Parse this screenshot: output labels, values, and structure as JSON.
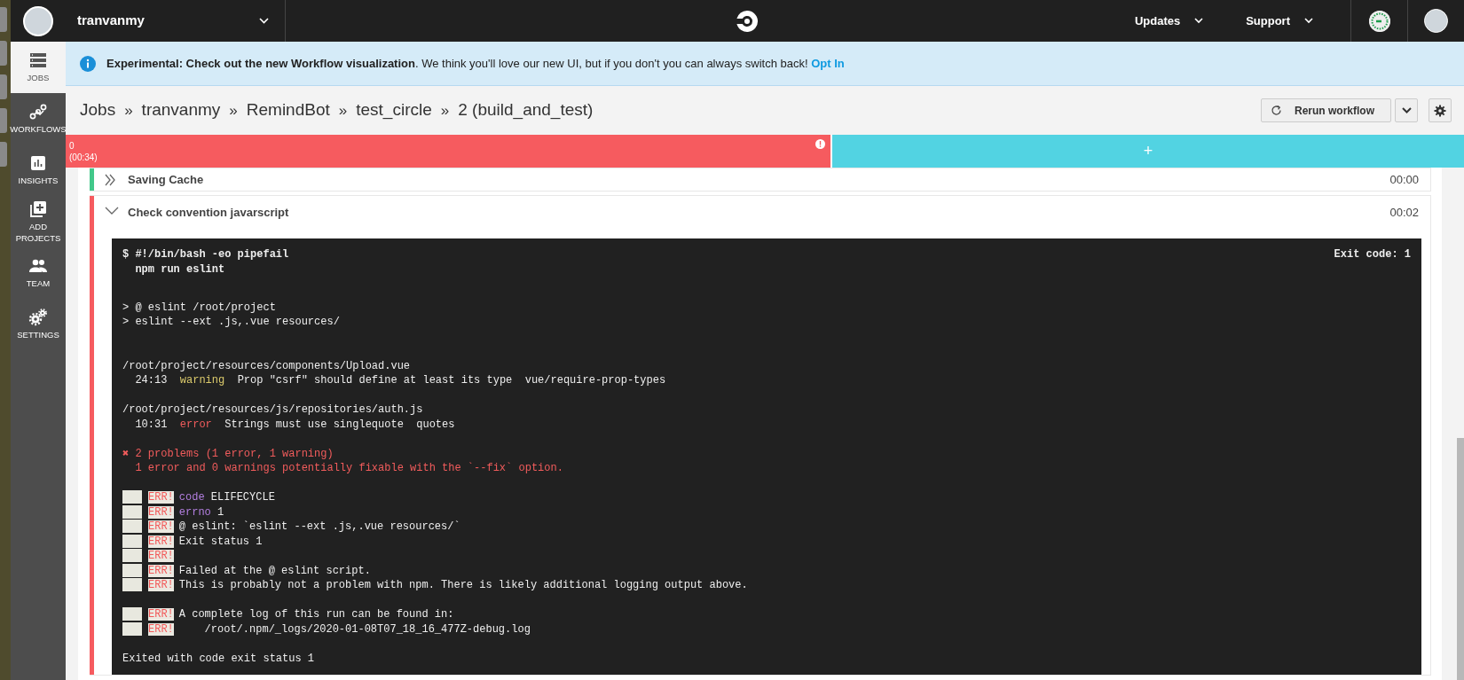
{
  "topbar": {
    "org_name": "tranvanmy",
    "menus": [
      {
        "label": "Updates"
      },
      {
        "label": "Support"
      }
    ]
  },
  "sidebar": {
    "items": [
      {
        "label": "JOBS",
        "selected": true
      },
      {
        "label": "WORKFLOWS",
        "selected": false
      },
      {
        "label": "INSIGHTS",
        "selected": false
      },
      {
        "label": "ADD PROJECTS",
        "selected": false
      },
      {
        "label": "TEAM",
        "selected": false
      },
      {
        "label": "SETTINGS",
        "selected": false
      }
    ]
  },
  "banner": {
    "text": "**Experimental: Check out the new Workflow visualization**. We think you'll love our new UI, but if you don't you can always switch back!",
    "link": "Opt In"
  },
  "breadcrumb": {
    "separator": "»",
    "items": [
      "Jobs",
      "tranvanmy",
      "RemindBot",
      "test_circle",
      "2 (build_and_test)"
    ]
  },
  "actions": {
    "rerun": "Rerun workflow"
  },
  "workflow_bar": {
    "jobs": [
      {
        "label": "0",
        "duration": "(00:34)",
        "color": "#f65b5f"
      }
    ],
    "add": "+"
  },
  "steps": [
    {
      "name": "Saving Cache",
      "time": "00:00",
      "color": "#42c88a",
      "expanded": false
    },
    {
      "name": "Check convention javarscript",
      "time": "00:02",
      "color": "#f65b5f",
      "expanded": true,
      "exit_code": "Exit code: 1",
      "command": [
        "$ #!/bin/bash -eo pipefail",
        "  npm run eslint"
      ],
      "log": [
        {
          "kind": "blank"
        },
        {
          "kind": "text",
          "segments": [
            {
              "text": "> @ eslint /root/project"
            }
          ]
        },
        {
          "kind": "text",
          "segments": [
            {
              "text": "> eslint --ext .js,.vue resources/"
            }
          ]
        },
        {
          "kind": "blank"
        },
        {
          "kind": "blank"
        },
        {
          "kind": "text",
          "segments": [
            {
              "text": "/root/project/resources/components/Upload.vue"
            }
          ]
        },
        {
          "kind": "text",
          "segments": [
            {
              "text": "  24:13  "
            },
            {
              "text": "warning",
              "color": "#dccb6c"
            },
            {
              "text": "  Prop \"csrf\" should define at least its type  vue/require-prop-types"
            }
          ]
        },
        {
          "kind": "blank"
        },
        {
          "kind": "text",
          "segments": [
            {
              "text": "/root/project/resources/js/repositories/auth.js"
            }
          ]
        },
        {
          "kind": "text",
          "segments": [
            {
              "text": "  10:31  "
            },
            {
              "text": "error",
              "color": "#f25c5c"
            },
            {
              "text": "  Strings must use singlequote  quotes"
            }
          ]
        },
        {
          "kind": "blank"
        },
        {
          "kind": "text",
          "segments": [
            {
              "text": "✖ 2 problems (1 error, 1 warning)",
              "color": "#f25c5c"
            }
          ]
        },
        {
          "kind": "text",
          "segments": [
            {
              "text": "  1 error and 0 warnings potentially fixable with the `--fix` option.",
              "color": "#f25c5c"
            }
          ]
        },
        {
          "kind": "blank"
        },
        {
          "kind": "npm",
          "badge": "ERR!",
          "segments": [
            {
              "text": "code",
              "color": "#b37fe0"
            },
            {
              "text": " ELIFECYCLE"
            }
          ]
        },
        {
          "kind": "npm",
          "badge": "ERR!",
          "segments": [
            {
              "text": "errno",
              "color": "#b37fe0"
            },
            {
              "text": " 1"
            }
          ]
        },
        {
          "kind": "npm",
          "badge": "ERR!",
          "segments": [
            {
              "text": "@ eslint: `eslint --ext .js,.vue resources/`"
            }
          ]
        },
        {
          "kind": "npm",
          "badge": "ERR!",
          "segments": [
            {
              "text": "Exit status 1"
            }
          ]
        },
        {
          "kind": "npm",
          "badge": "ERR!"
        },
        {
          "kind": "npm",
          "badge": "ERR!",
          "segments": [
            {
              "text": "Failed at the @ eslint script."
            }
          ]
        },
        {
          "kind": "npm",
          "badge": "ERR!",
          "segments": [
            {
              "text": "This is probably not a problem with npm. There is likely additional logging output above."
            }
          ]
        },
        {
          "kind": "blank"
        },
        {
          "kind": "npm",
          "badge": "ERR!",
          "segments": [
            {
              "text": "A complete log of this run can be found in:"
            }
          ]
        },
        {
          "kind": "npm",
          "badge": "ERR!",
          "segments": [
            {
              "text": "    /root/.npm/_logs/2020-01-08T07_18_16_477Z-debug.log"
            }
          ]
        },
        {
          "kind": "blank"
        },
        {
          "kind": "text",
          "segments": [
            {
              "text": "Exited with code exit status 1"
            }
          ]
        }
      ]
    }
  ]
}
